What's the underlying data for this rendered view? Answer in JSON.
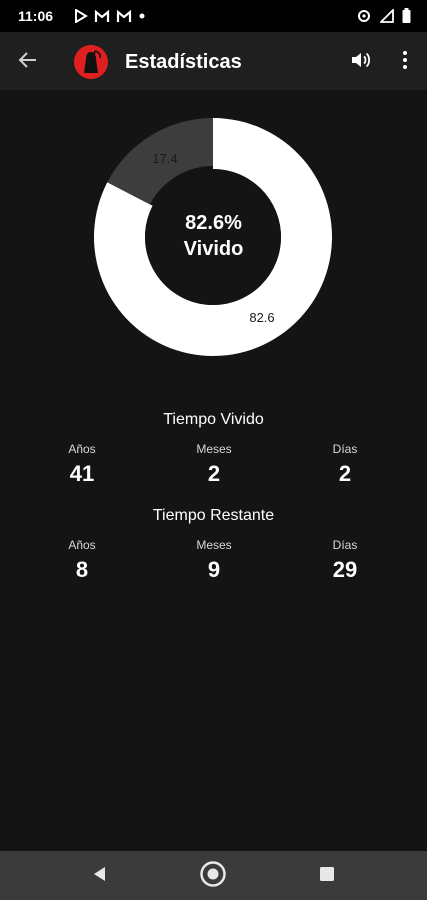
{
  "status_bar": {
    "time": "11:06",
    "left_icons": [
      "play-store-icon",
      "gmail-icon",
      "gmail-icon",
      "dot-icon"
    ],
    "right_icons": [
      "data-saver-icon",
      "signal-icon",
      "battery-icon"
    ]
  },
  "app_bar": {
    "title": "Estadísticas",
    "logo_icon": "grim-reaper-logo",
    "actions": [
      "volume-icon",
      "more-vert-icon"
    ]
  },
  "chart_data": {
    "type": "pie",
    "donut": true,
    "slices": [
      {
        "label": "82.6",
        "value": 82.6,
        "color": "#ffffff"
      },
      {
        "label": "17.4",
        "value": 17.4,
        "color": "#3d3d3d"
      }
    ],
    "center_text": [
      "82.6%",
      "Vivido"
    ]
  },
  "lived": {
    "title": "Tiempo Vivido",
    "labels": [
      "Años",
      "Meses",
      "Días"
    ],
    "values": [
      "41",
      "2",
      "2"
    ]
  },
  "remaining": {
    "title": "Tiempo Restante",
    "labels": [
      "Años",
      "Meses",
      "Días"
    ],
    "values": [
      "8",
      "9",
      "29"
    ]
  },
  "colors": {
    "background": "#141414",
    "app_bar": "#1f1f1f",
    "accent": "#e02020",
    "nav_bar": "#3b3b3b"
  }
}
